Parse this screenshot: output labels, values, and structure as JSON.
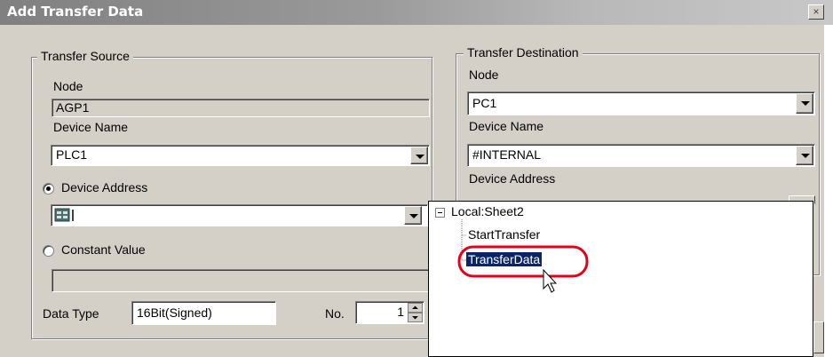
{
  "window": {
    "title": "Add Transfer Data",
    "close_glyph": "×"
  },
  "transfer_source": {
    "legend": "Transfer Source",
    "node_label": "Node",
    "node_value": "AGP1",
    "device_name_label": "Device Name",
    "device_name_value": "PLC1",
    "device_address_label": "Device Address",
    "constant_value_label": "Constant Value",
    "data_type_label": "Data Type",
    "data_type_value": "16Bit(Signed)",
    "no_label": "No.",
    "no_value": "1"
  },
  "transfer_destination": {
    "legend": "Transfer Destination",
    "node_label": "Node",
    "node_value": "PC1",
    "device_name_label": "Device Name",
    "device_name_value": "#INTERNAL",
    "device_address_label": "Device Address"
  },
  "tree": {
    "root": "Local:Sheet2",
    "expand_glyph": "⊟",
    "children": [
      "StartTransfer",
      "TransferData"
    ]
  },
  "highlight_color": "#e2001a",
  "selection_color": "#0a246a"
}
